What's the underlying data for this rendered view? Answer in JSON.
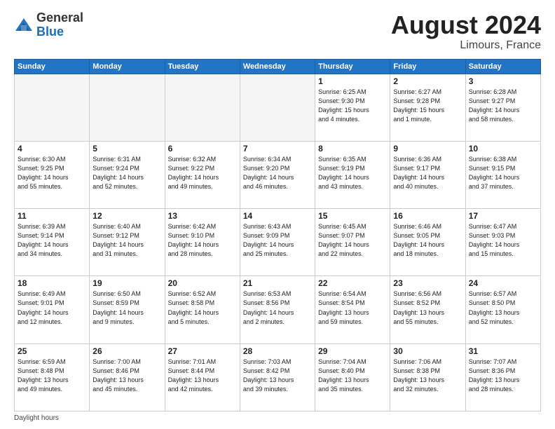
{
  "header": {
    "logo_general": "General",
    "logo_blue": "Blue",
    "month_year": "August 2024",
    "location": "Limours, France"
  },
  "footer": {
    "label": "Daylight hours"
  },
  "days_of_week": [
    "Sunday",
    "Monday",
    "Tuesday",
    "Wednesday",
    "Thursday",
    "Friday",
    "Saturday"
  ],
  "weeks": [
    [
      {
        "day": "",
        "info": ""
      },
      {
        "day": "",
        "info": ""
      },
      {
        "day": "",
        "info": ""
      },
      {
        "day": "",
        "info": ""
      },
      {
        "day": "1",
        "info": "Sunrise: 6:25 AM\nSunset: 9:30 PM\nDaylight: 15 hours\nand 4 minutes."
      },
      {
        "day": "2",
        "info": "Sunrise: 6:27 AM\nSunset: 9:28 PM\nDaylight: 15 hours\nand 1 minute."
      },
      {
        "day": "3",
        "info": "Sunrise: 6:28 AM\nSunset: 9:27 PM\nDaylight: 14 hours\nand 58 minutes."
      }
    ],
    [
      {
        "day": "4",
        "info": "Sunrise: 6:30 AM\nSunset: 9:25 PM\nDaylight: 14 hours\nand 55 minutes."
      },
      {
        "day": "5",
        "info": "Sunrise: 6:31 AM\nSunset: 9:24 PM\nDaylight: 14 hours\nand 52 minutes."
      },
      {
        "day": "6",
        "info": "Sunrise: 6:32 AM\nSunset: 9:22 PM\nDaylight: 14 hours\nand 49 minutes."
      },
      {
        "day": "7",
        "info": "Sunrise: 6:34 AM\nSunset: 9:20 PM\nDaylight: 14 hours\nand 46 minutes."
      },
      {
        "day": "8",
        "info": "Sunrise: 6:35 AM\nSunset: 9:19 PM\nDaylight: 14 hours\nand 43 minutes."
      },
      {
        "day": "9",
        "info": "Sunrise: 6:36 AM\nSunset: 9:17 PM\nDaylight: 14 hours\nand 40 minutes."
      },
      {
        "day": "10",
        "info": "Sunrise: 6:38 AM\nSunset: 9:15 PM\nDaylight: 14 hours\nand 37 minutes."
      }
    ],
    [
      {
        "day": "11",
        "info": "Sunrise: 6:39 AM\nSunset: 9:14 PM\nDaylight: 14 hours\nand 34 minutes."
      },
      {
        "day": "12",
        "info": "Sunrise: 6:40 AM\nSunset: 9:12 PM\nDaylight: 14 hours\nand 31 minutes."
      },
      {
        "day": "13",
        "info": "Sunrise: 6:42 AM\nSunset: 9:10 PM\nDaylight: 14 hours\nand 28 minutes."
      },
      {
        "day": "14",
        "info": "Sunrise: 6:43 AM\nSunset: 9:09 PM\nDaylight: 14 hours\nand 25 minutes."
      },
      {
        "day": "15",
        "info": "Sunrise: 6:45 AM\nSunset: 9:07 PM\nDaylight: 14 hours\nand 22 minutes."
      },
      {
        "day": "16",
        "info": "Sunrise: 6:46 AM\nSunset: 9:05 PM\nDaylight: 14 hours\nand 18 minutes."
      },
      {
        "day": "17",
        "info": "Sunrise: 6:47 AM\nSunset: 9:03 PM\nDaylight: 14 hours\nand 15 minutes."
      }
    ],
    [
      {
        "day": "18",
        "info": "Sunrise: 6:49 AM\nSunset: 9:01 PM\nDaylight: 14 hours\nand 12 minutes."
      },
      {
        "day": "19",
        "info": "Sunrise: 6:50 AM\nSunset: 8:59 PM\nDaylight: 14 hours\nand 9 minutes."
      },
      {
        "day": "20",
        "info": "Sunrise: 6:52 AM\nSunset: 8:58 PM\nDaylight: 14 hours\nand 5 minutes."
      },
      {
        "day": "21",
        "info": "Sunrise: 6:53 AM\nSunset: 8:56 PM\nDaylight: 14 hours\nand 2 minutes."
      },
      {
        "day": "22",
        "info": "Sunrise: 6:54 AM\nSunset: 8:54 PM\nDaylight: 13 hours\nand 59 minutes."
      },
      {
        "day": "23",
        "info": "Sunrise: 6:56 AM\nSunset: 8:52 PM\nDaylight: 13 hours\nand 55 minutes."
      },
      {
        "day": "24",
        "info": "Sunrise: 6:57 AM\nSunset: 8:50 PM\nDaylight: 13 hours\nand 52 minutes."
      }
    ],
    [
      {
        "day": "25",
        "info": "Sunrise: 6:59 AM\nSunset: 8:48 PM\nDaylight: 13 hours\nand 49 minutes."
      },
      {
        "day": "26",
        "info": "Sunrise: 7:00 AM\nSunset: 8:46 PM\nDaylight: 13 hours\nand 45 minutes."
      },
      {
        "day": "27",
        "info": "Sunrise: 7:01 AM\nSunset: 8:44 PM\nDaylight: 13 hours\nand 42 minutes."
      },
      {
        "day": "28",
        "info": "Sunrise: 7:03 AM\nSunset: 8:42 PM\nDaylight: 13 hours\nand 39 minutes."
      },
      {
        "day": "29",
        "info": "Sunrise: 7:04 AM\nSunset: 8:40 PM\nDaylight: 13 hours\nand 35 minutes."
      },
      {
        "day": "30",
        "info": "Sunrise: 7:06 AM\nSunset: 8:38 PM\nDaylight: 13 hours\nand 32 minutes."
      },
      {
        "day": "31",
        "info": "Sunrise: 7:07 AM\nSunset: 8:36 PM\nDaylight: 13 hours\nand 28 minutes."
      }
    ]
  ]
}
